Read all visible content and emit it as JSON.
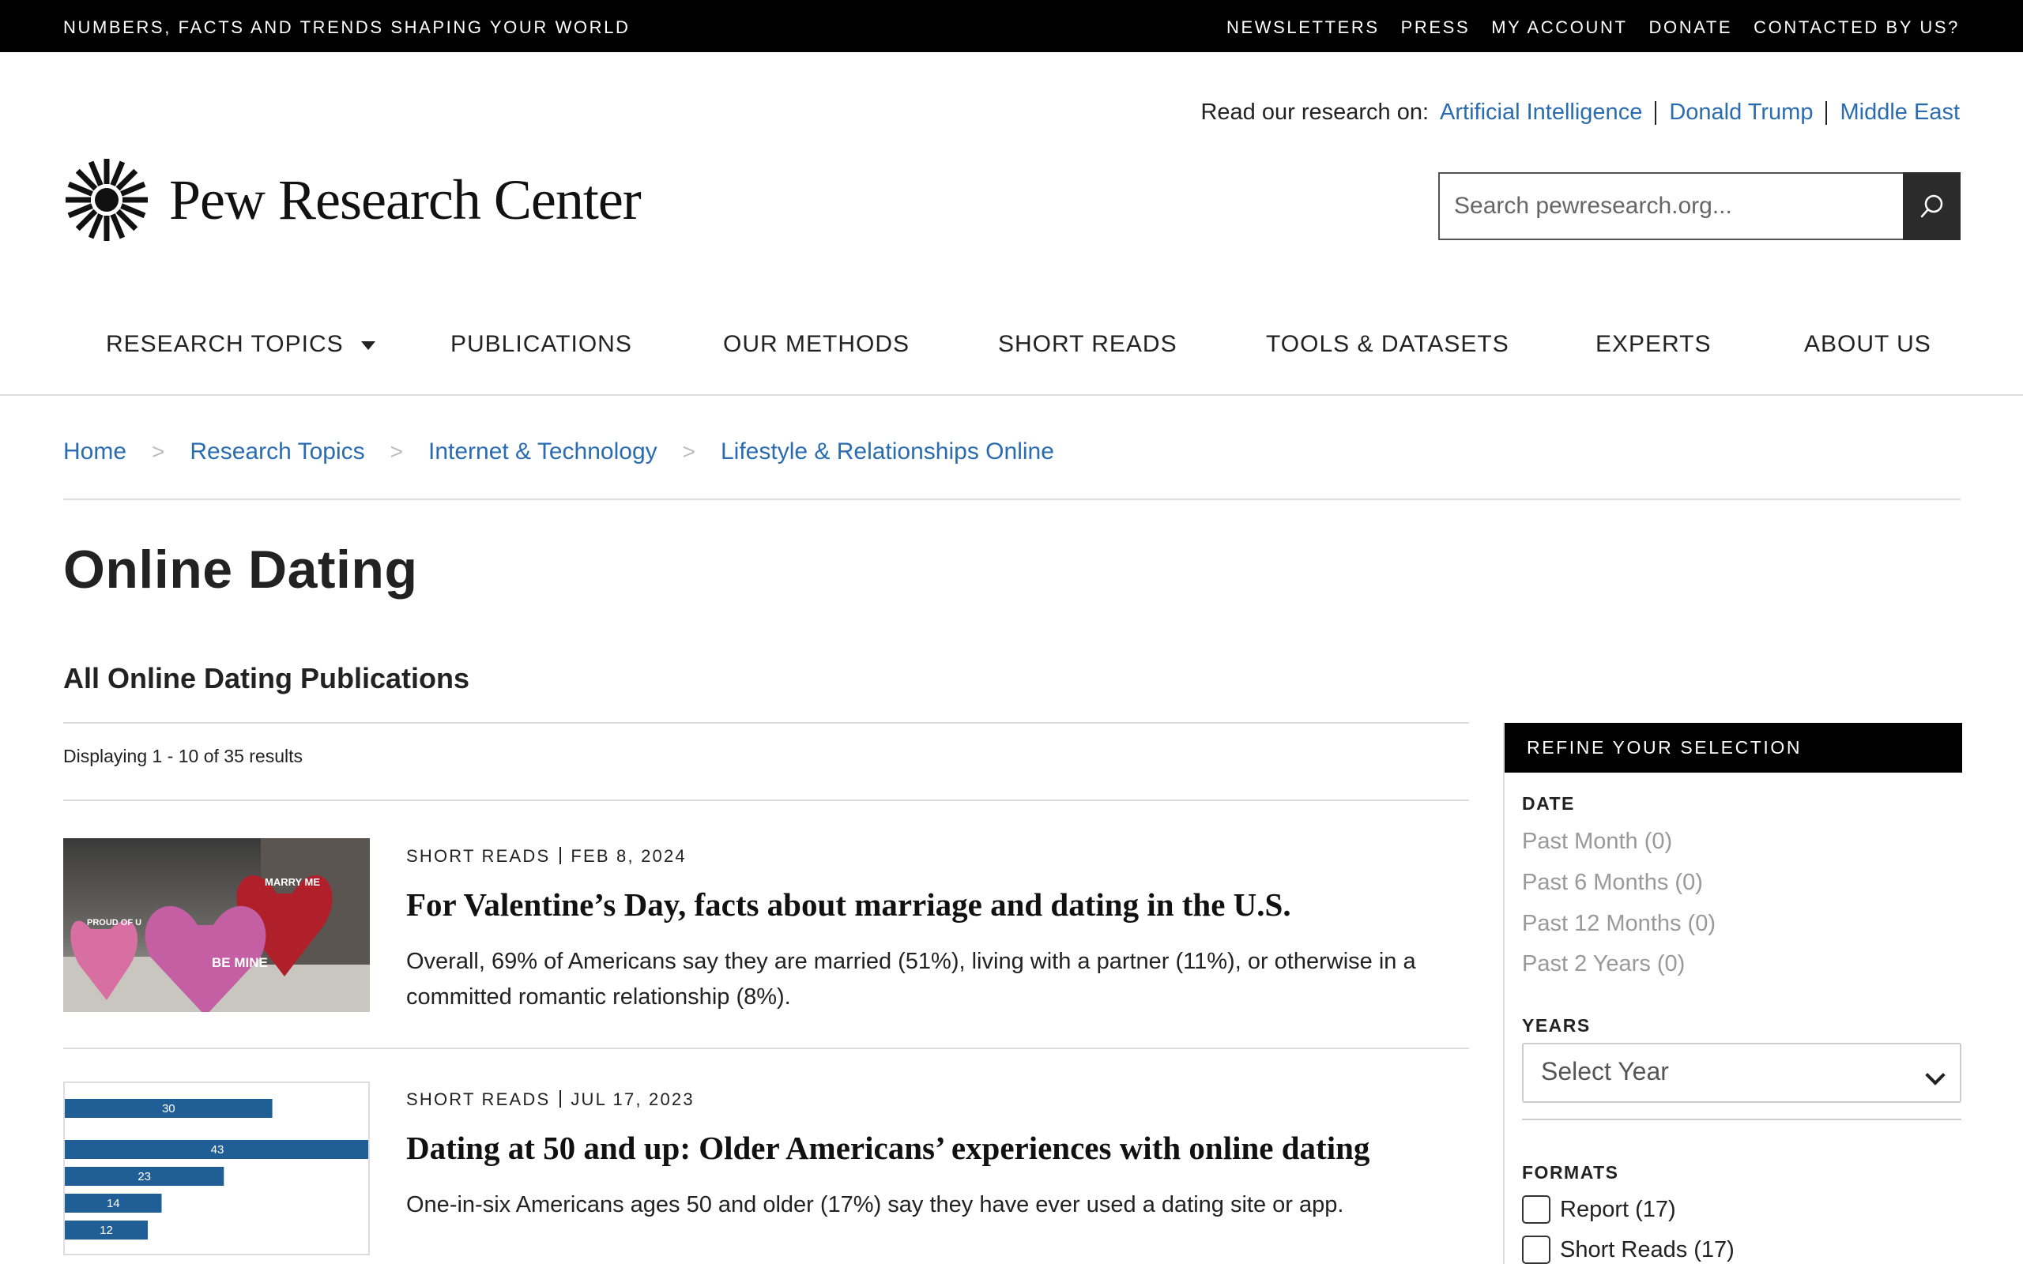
{
  "topbar": {
    "tagline": "NUMBERS, FACTS AND TRENDS SHAPING YOUR WORLD",
    "links": [
      "NEWSLETTERS",
      "PRESS",
      "MY ACCOUNT",
      "DONATE",
      "CONTACTED BY US?"
    ]
  },
  "header": {
    "read_on_label": "Read our research on:",
    "read_on_links": [
      "Artificial Intelligence",
      "Donald Trump",
      "Middle East"
    ],
    "logo_text": "Pew Research Center",
    "search_placeholder": "Search pewresearch.org...",
    "search_icon": "search-icon"
  },
  "nav": {
    "items": [
      "RESEARCH TOPICS",
      "PUBLICATIONS",
      "OUR METHODS",
      "SHORT READS",
      "TOOLS & DATASETS",
      "EXPERTS",
      "ABOUT US"
    ]
  },
  "breadcrumb": {
    "items": [
      "Home",
      "Research Topics",
      "Internet & Technology",
      "Lifestyle & Relationships Online"
    ],
    "separator": ">"
  },
  "page": {
    "title": "Online Dating",
    "section_title": "All Online Dating Publications",
    "displaying": "Displaying 1 - 10 of 35 results"
  },
  "results": [
    {
      "type": "SHORT READS",
      "date": "FEB 8, 2024",
      "title": "For Valentine’s Day, facts about marriage and dating in the U.S.",
      "description": "Overall, 69% of Americans say they are married (51%), living with a partner (11%), or otherwise in a committed romantic relationship (8%).",
      "thumb_labels": [
        "PROUD OF U",
        "MARRY ME",
        "BE MINE"
      ]
    },
    {
      "type": "SHORT READS",
      "date": "JUL 17, 2023",
      "title": "Dating at 50 and up: Older Americans’ experiences with online dating",
      "description": "One-in-six Americans ages 50 and older (17%) say they have ever used a dating site or app.",
      "thumb_values": [
        30,
        43,
        23,
        14,
        12
      ]
    }
  ],
  "sidebar": {
    "heading": "REFINE YOUR SELECTION",
    "date_label": "DATE",
    "date_options": [
      "Past Month (0)",
      "Past 6 Months (0)",
      "Past 12 Months (0)",
      "Past 2 Years (0)"
    ],
    "years_label": "YEARS",
    "years_select": "Select Year",
    "formats_label": "FORMATS",
    "formats": [
      "Report (17)",
      "Short Reads (17)"
    ]
  },
  "colors": {
    "link": "#2a6cb0",
    "topbar": "#000000",
    "bar_blue": "#1f5f96"
  }
}
